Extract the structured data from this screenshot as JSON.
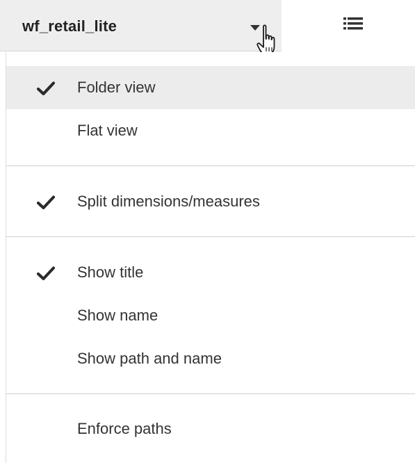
{
  "header": {
    "source_label": "wf_retail_lite",
    "dropdown_icon": "caret-down-icon",
    "cursor_icon": "hand-pointer-icon",
    "view_toggle_icon": "list-icon"
  },
  "menu": {
    "items": [
      {
        "label": "Folder view",
        "checked": true,
        "highlighted": true
      },
      {
        "label": "Flat view",
        "checked": false
      },
      {
        "label": "Split dimensions/measures",
        "checked": true
      },
      {
        "label": "Show title",
        "checked": true
      },
      {
        "label": "Show name",
        "checked": false
      },
      {
        "label": "Show path and name",
        "checked": false
      },
      {
        "label": "Enforce paths",
        "checked": false
      }
    ]
  },
  "colors": {
    "header_bg": "#eeeeee",
    "highlight_bg": "#ececec",
    "text": "#333333",
    "divider": "#cfcfcf"
  }
}
